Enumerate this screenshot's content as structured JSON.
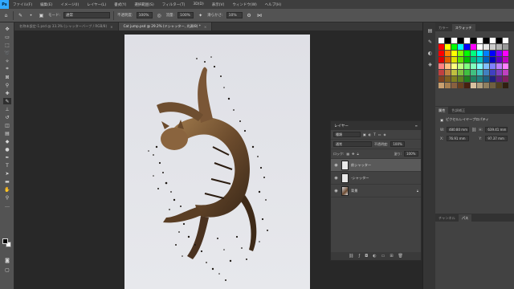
{
  "app": {
    "logo": "Ps"
  },
  "menu": [
    "ファイル(F)",
    "編集(E)",
    "イメージ(I)",
    "レイヤー(L)",
    "書式(Y)",
    "選択範囲(S)",
    "フィルター(T)",
    "3D(D)",
    "表示(V)",
    "ウィンドウ(W)",
    "ヘルプ(H)"
  ],
  "options": {
    "mode_label": "モード:",
    "mode_value": "通常",
    "opacity_label": "不透明度:",
    "opacity_value": "100%",
    "flow_label": "流量:",
    "flow_value": "100%",
    "smoothing_label": "滑らかさ:",
    "smoothing_value": "10%"
  },
  "tabs": [
    {
      "label": "名称未設定-1.psd @ 33.3% (シャッターバーブ / RGB/8)",
      "active": false
    },
    {
      "label": "Cat jump.psd @ 29.2% (ドシャッター, 光源/8) *",
      "active": true
    }
  ],
  "layers_panel": {
    "title": "レイヤー",
    "filter_label": "種類",
    "blend_mode": "通常",
    "opacity_label": "不透明度:",
    "opacity_value": "100%",
    "lock_label": "ロック:",
    "fill_label": "塗り:",
    "fill_value": "100%",
    "layers": [
      {
        "name": "前シャッター",
        "selected": true,
        "photo": false
      },
      {
        "name": "-シャッター",
        "selected": false,
        "photo": false
      },
      {
        "name": "背景",
        "selected": false,
        "photo": true
      }
    ]
  },
  "right_panel": {
    "tabs": [
      "カラー",
      "スウォッチ"
    ],
    "active_tab": "スウォッチ",
    "props_tabs": [
      "属性",
      "色調補正"
    ],
    "props_title": "ピクセルレイヤープロパティ",
    "w_label": "W:",
    "w_value": "480.80 mm",
    "h_label": "H:",
    "h_value": "639.41 mm",
    "x_label": "X:",
    "x_value": "76.91 mm",
    "y_label": "Y:",
    "y_value": "97.37 mm",
    "bottom_tabs": [
      "チャンネル",
      "パス"
    ]
  },
  "colors": {
    "swatches": [
      "#ffffff",
      "#000000",
      "#ffffff",
      "#000000",
      "#ffffff",
      "#000000",
      "#ffffff",
      "#000000",
      "#ffffff",
      "#000000",
      "#ffffff",
      "#ff0000",
      "#ffff00",
      "#00ff00",
      "#00ffff",
      "#0000ff",
      "#ff00ff",
      "#ffffff",
      "#e6e6e6",
      "#cccccc",
      "#b3b3b3",
      "#999999",
      "#ff0000",
      "#ff8000",
      "#ffff00",
      "#80ff00",
      "#00ff00",
      "#00ff80",
      "#00ffff",
      "#0080ff",
      "#0000ff",
      "#8000ff",
      "#ff00ff",
      "#e00000",
      "#e06000",
      "#e0e000",
      "#60e000",
      "#00c000",
      "#00c080",
      "#00c0c0",
      "#0060c0",
      "#0000c0",
      "#6000c0",
      "#c000c0",
      "#ff8080",
      "#ffbf80",
      "#ffff80",
      "#bfff80",
      "#80ff80",
      "#80ffbf",
      "#80ffff",
      "#80bfff",
      "#8080ff",
      "#bf80ff",
      "#ff80ff",
      "#c04040",
      "#c08040",
      "#c0c040",
      "#80c040",
      "#40c040",
      "#40c080",
      "#40c0c0",
      "#4080c0",
      "#4040c0",
      "#8040c0",
      "#c040c0",
      "#804020",
      "#806020",
      "#808020",
      "#608020",
      "#208020",
      "#208060",
      "#208080",
      "#206080",
      "#202080",
      "#602080",
      "#802060",
      "#c8a070",
      "#a88050",
      "#886040",
      "#684020",
      "#482010",
      "#d8c0a0",
      "#b0a080",
      "#908060",
      "#706040",
      "#504020",
      "#302010"
    ]
  }
}
